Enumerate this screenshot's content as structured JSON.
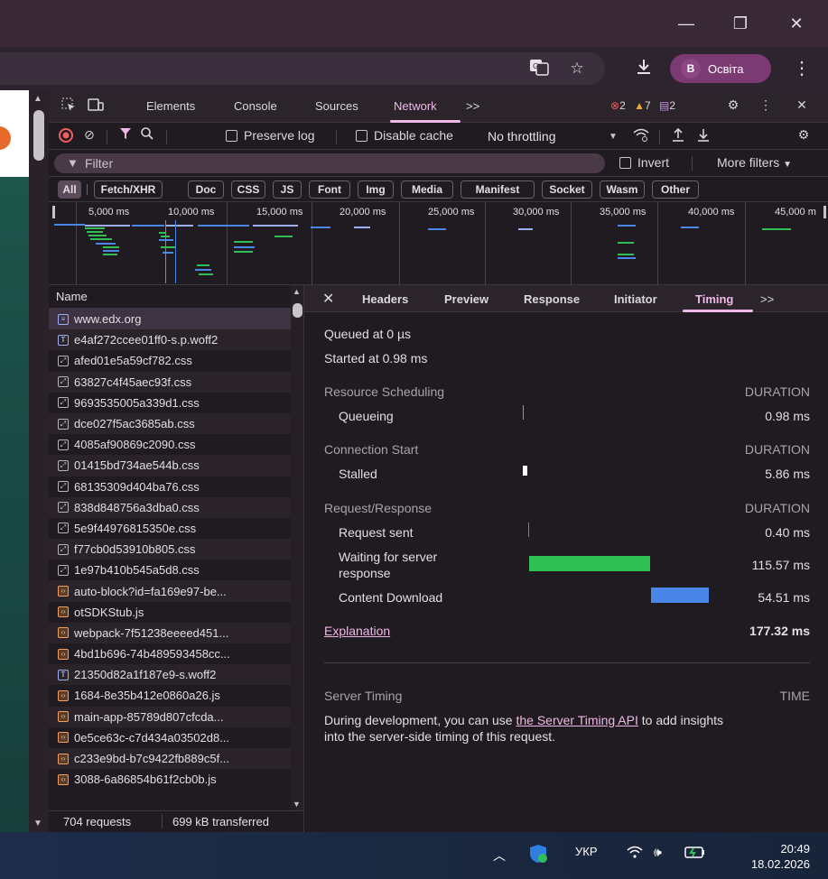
{
  "window": {
    "minimize_icon": "—",
    "restore_icon": "❐",
    "close_icon": "✕"
  },
  "addressbar": {
    "profile_initial": "B",
    "profile_name": "Освіта"
  },
  "devtools": {
    "tabs": [
      "Elements",
      "Console",
      "Sources",
      "Network"
    ],
    "active_tab": "Network",
    "more_tabs": ">>",
    "errors": "2",
    "warnings": "7",
    "messages": "2",
    "close": "✕",
    "toolbar": {
      "preserve_log": "Preserve log",
      "disable_cache": "Disable cache",
      "throttling": "No throttling"
    },
    "filter": {
      "placeholder": "Filter",
      "invert": "Invert",
      "more_filters": "More filters"
    },
    "type_filters": [
      "All",
      "Fetch/XHR",
      "Doc",
      "CSS",
      "JS",
      "Font",
      "Img",
      "Media",
      "Manifest",
      "Socket",
      "Wasm",
      "Other"
    ],
    "overview_ticks": [
      "5,000 ms",
      "10,000 ms",
      "15,000 ms",
      "20,000 ms",
      "25,000 ms",
      "30,000 ms",
      "35,000 ms",
      "40,000 ms",
      "45,000 m"
    ],
    "requests": {
      "header": "Name",
      "items": [
        {
          "name": "www.edx.org",
          "type": "doc"
        },
        {
          "name": "e4af272ccee01ff0-s.p.woff2",
          "type": "font"
        },
        {
          "name": "afed01e5a59cf782.css",
          "type": "css"
        },
        {
          "name": "63827c4f45aec93f.css",
          "type": "css"
        },
        {
          "name": "9693535005a339d1.css",
          "type": "css"
        },
        {
          "name": "dce027f5ac3685ab.css",
          "type": "css"
        },
        {
          "name": "4085af90869c2090.css",
          "type": "css"
        },
        {
          "name": "01415bd734ae544b.css",
          "type": "css"
        },
        {
          "name": "68135309d404ba76.css",
          "type": "css"
        },
        {
          "name": "838d848756a3dba0.css",
          "type": "css"
        },
        {
          "name": "5e9f44976815350e.css",
          "type": "css"
        },
        {
          "name": "f77cb0d53910b805.css",
          "type": "css"
        },
        {
          "name": "1e97b410b545a5d8.css",
          "type": "css"
        },
        {
          "name": "auto-block?id=fa169e97-be...",
          "type": "js"
        },
        {
          "name": "otSDKStub.js",
          "type": "js"
        },
        {
          "name": "webpack-7f51238eeeed451...",
          "type": "js"
        },
        {
          "name": "4bd1b696-74b489593458cc...",
          "type": "js"
        },
        {
          "name": "21350d82a1f187e9-s.woff2",
          "type": "font"
        },
        {
          "name": "1684-8e35b412e0860a26.js",
          "type": "js"
        },
        {
          "name": "main-app-85789d807cfcda...",
          "type": "js"
        },
        {
          "name": "0e5ce63c-c7d434a03502d8...",
          "type": "js"
        },
        {
          "name": "c233e9bd-b7c9422fb889c5f...",
          "type": "js"
        },
        {
          "name": "3088-6a86854b61f2cb0b.js",
          "type": "js"
        }
      ],
      "count": "704 requests",
      "transferred": "699 kB transferred"
    },
    "detail_tabs": [
      "Headers",
      "Preview",
      "Response",
      "Initiator",
      "Timing"
    ],
    "detail_active": "Timing",
    "timing": {
      "queued_at": "Queued at 0 µs",
      "started_at": "Started at 0.98 ms",
      "resource_scheduling": "Resource Scheduling",
      "connection_start": "Connection Start",
      "request_response": "Request/Response",
      "duration_label": "DURATION",
      "queueing_label": "Queueing",
      "queueing_value": "0.98 ms",
      "stalled_label": "Stalled",
      "stalled_value": "5.86 ms",
      "request_sent_label": "Request sent",
      "request_sent_value": "0.40 ms",
      "waiting_label_1": "Waiting for server",
      "waiting_label_2": "response",
      "waiting_value": "115.57 ms",
      "download_label": "Content Download",
      "download_value": "54.51 ms",
      "explanation": "Explanation",
      "total": "177.32 ms",
      "server_timing": "Server Timing",
      "time_label": "TIME",
      "note_before": "During development, you can use ",
      "note_link": "the Server Timing API",
      "note_after": " to add insights",
      "note_line2": "into the server-side timing of this request."
    },
    "colors": {
      "accent": "#f0b8e8",
      "waiting_bar": "#2fbf55",
      "download_bar": "#4a86e8",
      "record_stop": "#f25d5d"
    }
  },
  "taskbar": {
    "lang": "УКР",
    "time": "20:49",
    "date": "18.02.2026"
  }
}
